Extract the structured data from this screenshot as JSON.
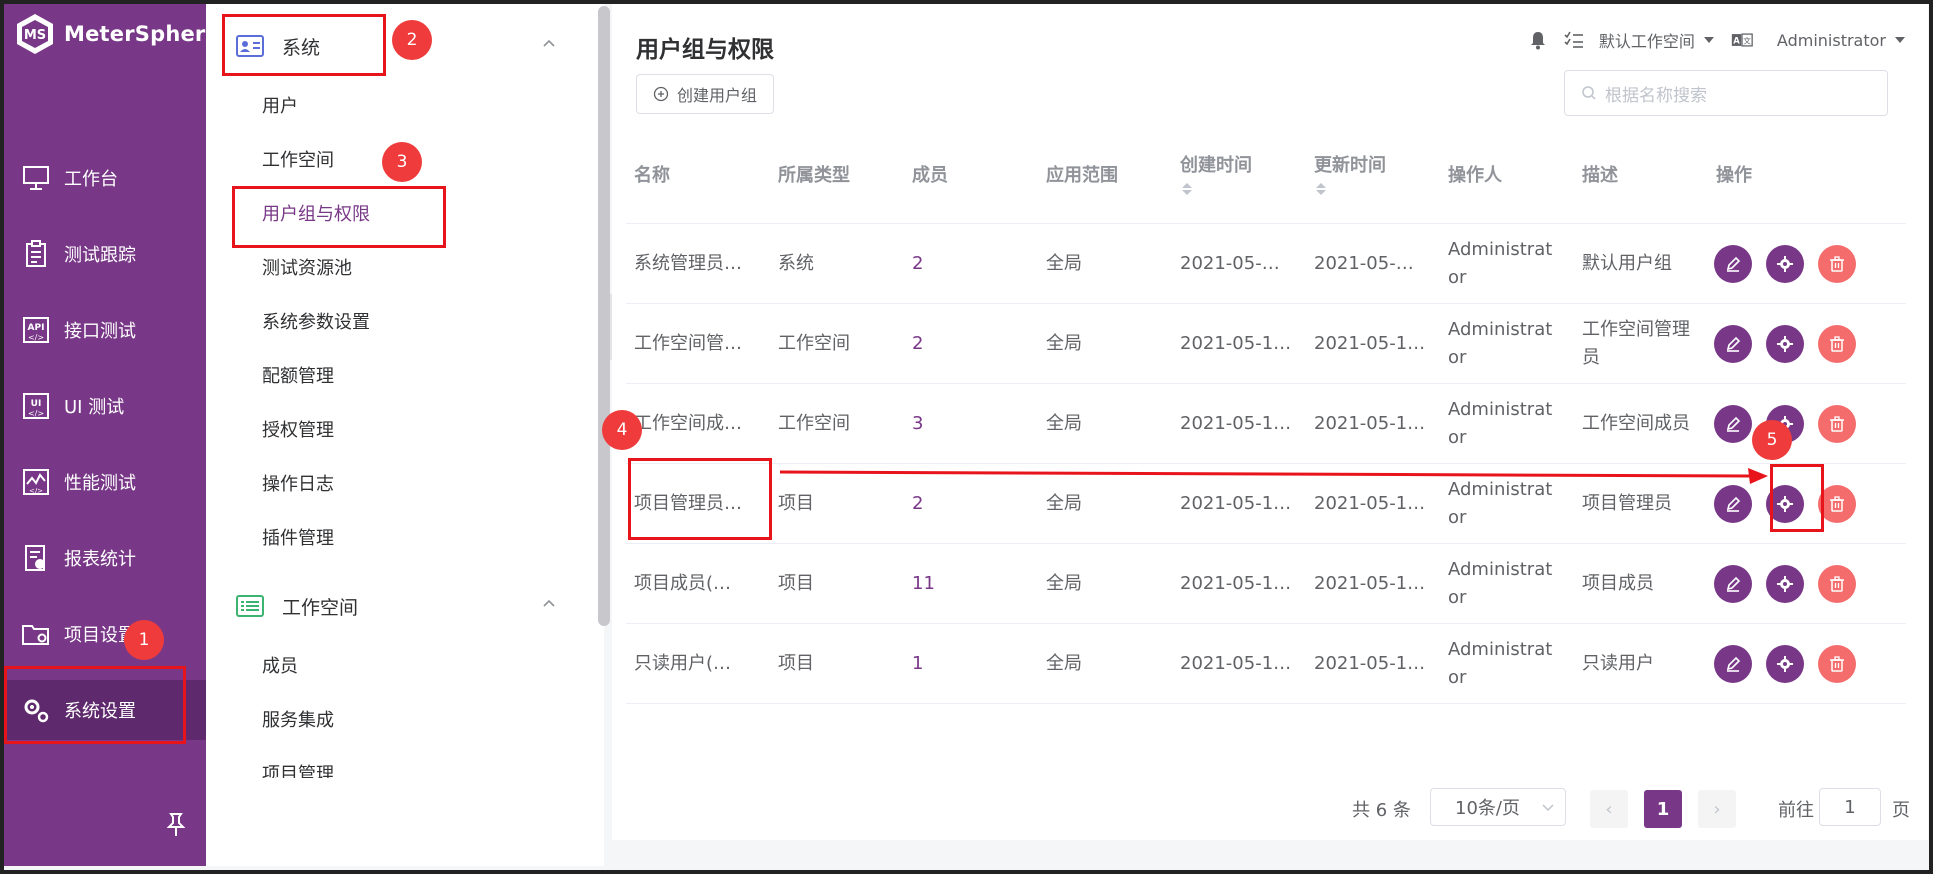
{
  "brand": {
    "name": "MeterSphere",
    "logo_letters": "MS"
  },
  "leftnav": {
    "items": [
      {
        "label": "工作台",
        "icon": "monitor-icon"
      },
      {
        "label": "测试跟踪",
        "icon": "clipboard-icon"
      },
      {
        "label": "接口测试",
        "icon": "api-icon"
      },
      {
        "label": "UI 测试",
        "icon": "ui-icon"
      },
      {
        "label": "性能测试",
        "icon": "performance-chart-icon"
      },
      {
        "label": "报表统计",
        "icon": "report-icon"
      },
      {
        "label": "项目设置",
        "icon": "folder-settings-icon"
      },
      {
        "label": "系统设置",
        "icon": "gears-icon",
        "active": true
      }
    ]
  },
  "subnav": {
    "group_system": {
      "label": "系统",
      "icon": "id-card-icon"
    },
    "system_items": [
      "用户",
      "工作空间",
      "用户组与权限",
      "测试资源池",
      "系统参数设置",
      "配额管理",
      "授权管理",
      "操作日志",
      "插件管理"
    ],
    "active_item": "用户组与权限",
    "group_workspace": {
      "label": "工作空间",
      "icon": "list-icon"
    },
    "workspace_items": [
      "成员",
      "服务集成",
      "项目管理"
    ]
  },
  "header": {
    "title": "用户组与权限",
    "create_button": "创建用户组",
    "workspace": "默认工作空间",
    "user": "Administrator",
    "search_placeholder": "根据名称搜索"
  },
  "table": {
    "columns": [
      "名称",
      "所属类型",
      "成员",
      "应用范围",
      "创建时间",
      "更新时间",
      "操作人",
      "描述",
      "操作"
    ],
    "rows": [
      {
        "name": "系统管理员…",
        "type": "系统",
        "members": "2",
        "scope": "全局",
        "created": "2021-05-…",
        "updated": "2021-05-…",
        "operator": "Administrator",
        "desc": "默认用户组"
      },
      {
        "name": "工作空间管…",
        "type": "工作空间",
        "members": "2",
        "scope": "全局",
        "created": "2021-05-1…",
        "updated": "2021-05-1…",
        "operator": "Administrator",
        "desc": "工作空间管理员"
      },
      {
        "name": "工作空间成…",
        "type": "工作空间",
        "members": "3",
        "scope": "全局",
        "created": "2021-05-1…",
        "updated": "2021-05-1…",
        "operator": "Administrator",
        "desc": "工作空间成员"
      },
      {
        "name": "项目管理员…",
        "type": "项目",
        "members": "2",
        "scope": "全局",
        "created": "2021-05-1…",
        "updated": "2021-05-1…",
        "operator": "Administrator",
        "desc": "项目管理员"
      },
      {
        "name": "项目成员(…",
        "type": "项目",
        "members": "11",
        "scope": "全局",
        "created": "2021-05-1…",
        "updated": "2021-05-1…",
        "operator": "Administrator",
        "desc": "项目成员"
      },
      {
        "name": "只读用户(…",
        "type": "项目",
        "members": "1",
        "scope": "全局",
        "created": "2021-05-1…",
        "updated": "2021-05-1…",
        "operator": "Administrator",
        "desc": "只读用户"
      }
    ]
  },
  "pagination": {
    "total": "共 6 条",
    "page_size": "10条/页",
    "current": "1",
    "goto_label": "前往",
    "goto_value": "1",
    "page_label": "页"
  },
  "annotations": [
    "1",
    "2",
    "3",
    "4",
    "5"
  ],
  "colors": {
    "brand": "#783887",
    "danger": "#f56c6c",
    "annotation": "#e8141b"
  }
}
